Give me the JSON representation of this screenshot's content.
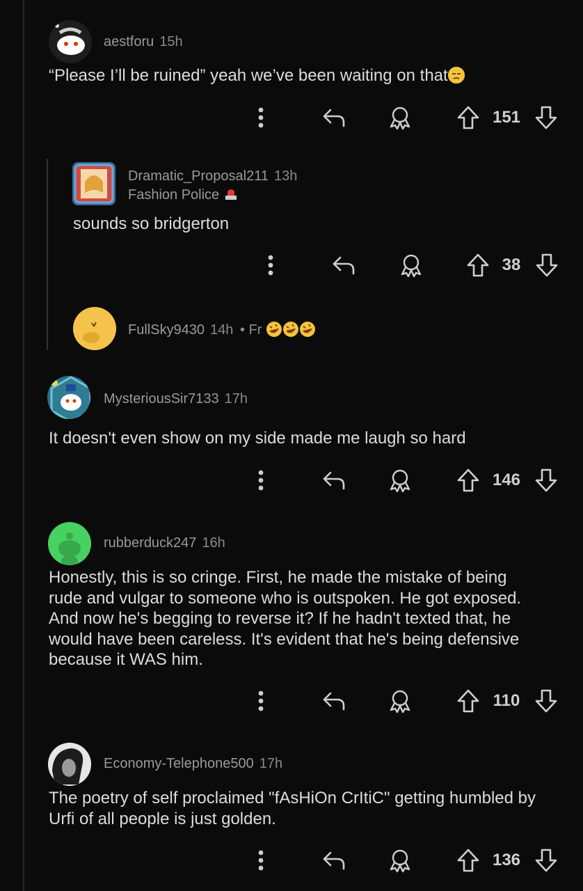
{
  "comments": [
    {
      "user": "aestforu",
      "time": "15h",
      "body": "“Please I’ll be ruined” yeah we’ve been waiting on that",
      "emoji": "unamused-face",
      "score": "151"
    },
    {
      "user": "Dramatic_Proposal211",
      "time": "13h",
      "flair": "Fashion Police",
      "flair_emoji": "police-light",
      "body": "sounds so bridgerton",
      "score": "38"
    },
    {
      "user": "FullSky9430",
      "time": "14h",
      "sep": "•",
      "collapsed_preview": "Fr",
      "emojis": [
        "rofl",
        "rofl",
        "rofl"
      ]
    },
    {
      "user": "MysteriousSir7133",
      "time": "17h",
      "body": "It doesn't even show on my side made me laugh so hard",
      "score": "146"
    },
    {
      "user": "rubberduck247",
      "time": "16h",
      "body_lines": [
        "Honestly, this is so cringe. First, he made the mistake of being",
        "rude and vulgar to someone who is outspoken. He got exposed.",
        "And now he's begging to reverse it? If he hadn't texted that, he",
        "would have been careless. It's evident that he's being defensive",
        "because it WAS him."
      ],
      "score": "110"
    },
    {
      "user": "Economy-Telephone500",
      "time": "17h",
      "body_lines": [
        "The poetry of self proclaimed \"fAsHiOn CrItiC\" getting humbled by",
        "Urfi of all people is just golden."
      ],
      "score": "136"
    }
  ],
  "icons": {
    "more": "more-vertical-icon",
    "reply": "reply-icon",
    "award": "award-icon",
    "upvote": "upvote-icon",
    "downvote": "downvote-icon"
  },
  "colors": {
    "background": "#0b0b0b",
    "text": "#dcdcdc",
    "muted": "#9a9a9a"
  }
}
